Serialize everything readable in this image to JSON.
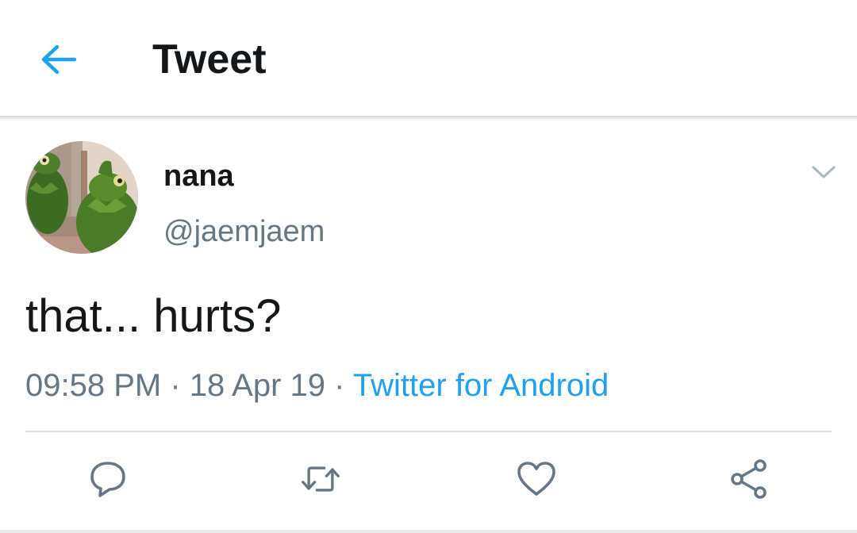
{
  "header": {
    "title": "Tweet",
    "back_icon": "arrow-left-icon",
    "accent_color": "#1da1f2"
  },
  "tweet": {
    "display_name": "nana",
    "handle": "@jaemjaem",
    "text": "that... hurts?",
    "time": "09:58 PM",
    "separator": " · ",
    "date": "18 Apr 19",
    "source": "Twitter for Android",
    "avatar_description_icon": "kermit-avatar",
    "menu_icon": "chevron-down-icon"
  },
  "actions": {
    "reply_icon": "reply-icon",
    "retweet_icon": "retweet-icon",
    "like_icon": "heart-icon",
    "share_icon": "share-icon",
    "icon_color": "#657786"
  }
}
